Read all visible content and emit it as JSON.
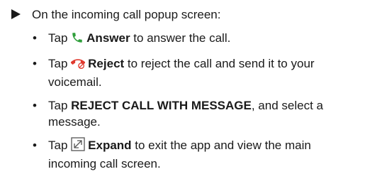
{
  "intro": "On the incoming call popup screen:",
  "bullet_char": "•",
  "items": [
    {
      "tap": "Tap",
      "icon": "phone-answer-icon",
      "label": "Answer",
      "rest": " to answer the call."
    },
    {
      "tap": "Tap",
      "icon": "phone-reject-icon",
      "label": "Reject",
      "rest": " to reject the call and send it to your voicemail."
    },
    {
      "tap": "Tap",
      "label": "REJECT CALL WITH MESSAGE",
      "rest": ", and select a message."
    },
    {
      "tap": "Tap",
      "icon": "expand-icon",
      "label": "Expand",
      "rest": " to exit the app and view the main incoming call screen."
    }
  ],
  "colors": {
    "answer_green": "#2e9e3a",
    "reject_red": "#e03a2f",
    "text": "#1a1a1a"
  }
}
